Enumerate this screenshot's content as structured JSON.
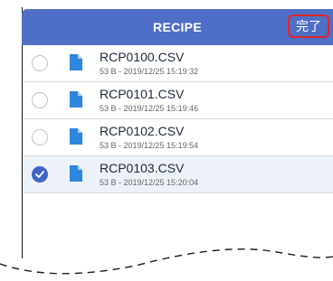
{
  "header": {
    "title": "RECIPE",
    "done_label": "完了"
  },
  "files": [
    {
      "name": "RCP0100.CSV",
      "meta": "53 B - 2019/12/25 15:19:32",
      "selected": false
    },
    {
      "name": "RCP0101.CSV",
      "meta": "53 B - 2019/12/25 15:19:46",
      "selected": false
    },
    {
      "name": "RCP0102.CSV",
      "meta": "53 B - 2019/12/25 15:19:54",
      "selected": false
    },
    {
      "name": "RCP0103.CSV",
      "meta": "53 B - 2019/12/25 15:20:04",
      "selected": true
    }
  ],
  "colors": {
    "header_bg": "#4f6fc6",
    "selected_bg": "#edf1f8",
    "check": "#3f64c5",
    "file_icon": "#2f86dd",
    "done_outline": "#e0252b"
  },
  "icons": {
    "file": "document-icon",
    "selection": "radio-check-icon"
  }
}
